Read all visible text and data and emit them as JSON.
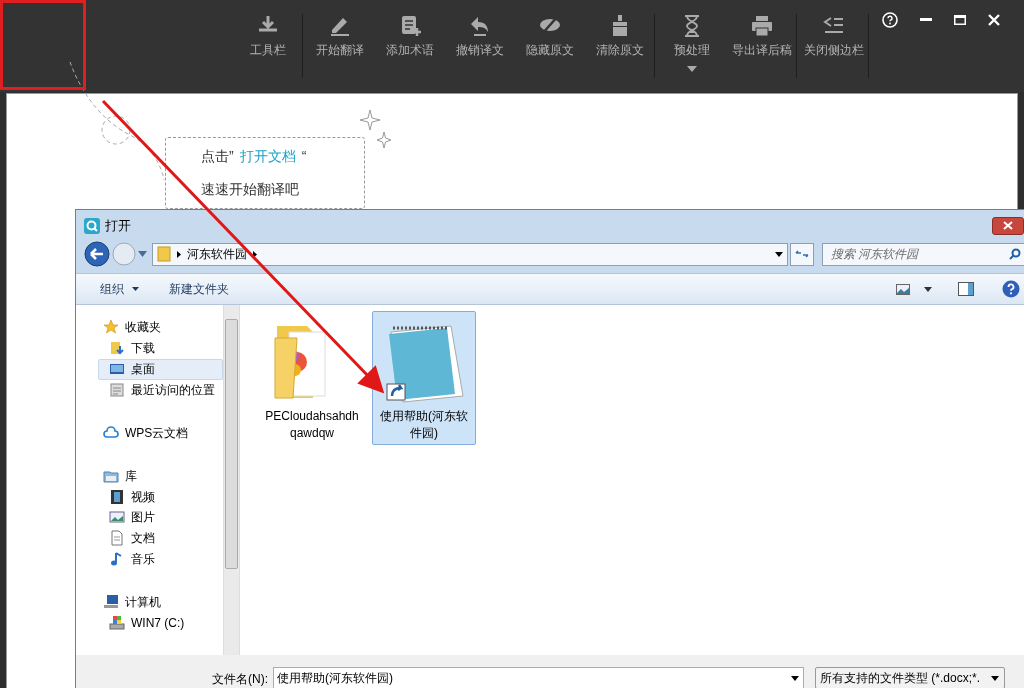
{
  "app_toolbar": {
    "buttons": [
      {
        "label": "工具栏",
        "kind": "download",
        "dropdown": false,
        "separator_after": true
      },
      {
        "label": "开始翻译",
        "kind": "pencil",
        "dropdown": false,
        "separator_after": false
      },
      {
        "label": "添加术语",
        "kind": "add-note",
        "dropdown": false,
        "separator_after": false
      },
      {
        "label": "撤销译文",
        "kind": "undo",
        "dropdown": false,
        "separator_after": false
      },
      {
        "label": "隐藏原文",
        "kind": "eye-off",
        "dropdown": false,
        "separator_after": false
      },
      {
        "label": "清除原文",
        "kind": "brush",
        "dropdown": false,
        "separator_after": true
      },
      {
        "label": "预处理",
        "kind": "hourglass",
        "dropdown": true,
        "separator_after": false
      },
      {
        "label": "导出译后稿",
        "kind": "printer",
        "dropdown": false,
        "separator_after": true
      },
      {
        "label": "关闭侧边栏",
        "kind": "close-sidebar",
        "dropdown": false,
        "separator_after": true
      }
    ]
  },
  "hint": {
    "before": "点击”",
    "link": "打开文档",
    "after": "“",
    "line2": "速速开始翻译吧"
  },
  "dialog": {
    "title": "打开",
    "breadcrumb": [
      "河东软件园"
    ],
    "search_placeholder": "搜索 河东软件园",
    "commands": [
      {
        "label": "组织",
        "dropdown": true
      },
      {
        "label": "新建文件夹",
        "dropdown": false
      }
    ],
    "nav": [
      {
        "label": "收藏夹",
        "kind": "star",
        "selected": false,
        "children": [
          {
            "label": "下载",
            "kind": "download-folder",
            "selected": false
          },
          {
            "label": "桌面",
            "kind": "desktop",
            "selected": true
          },
          {
            "label": "最近访问的位置",
            "kind": "recent",
            "selected": false
          }
        ]
      },
      {
        "label": "WPS云文档",
        "kind": "cloud",
        "selected": false
      },
      {
        "label": "库",
        "kind": "library",
        "selected": false,
        "children": [
          {
            "label": "视频",
            "kind": "video",
            "selected": false
          },
          {
            "label": "图片",
            "kind": "picture",
            "selected": false
          },
          {
            "label": "文档",
            "kind": "document",
            "selected": false
          },
          {
            "label": "音乐",
            "kind": "music",
            "selected": false
          }
        ]
      },
      {
        "label": "计算机",
        "kind": "computer",
        "selected": false,
        "children": [
          {
            "label": "WIN7 (C:)",
            "kind": "drive",
            "selected": false
          }
        ]
      }
    ],
    "files": [
      {
        "name": "PECloudahsahdhqawdqw",
        "kind": "folder",
        "selected": false
      },
      {
        "name": "使用帮助(河东软件园)",
        "kind": "notepad",
        "selected": true
      }
    ],
    "filename_label": "文件名(N):",
    "filename": "使用帮助(河东软件园)",
    "filetype": "所有支持的文件类型 (*.docx;*."
  }
}
